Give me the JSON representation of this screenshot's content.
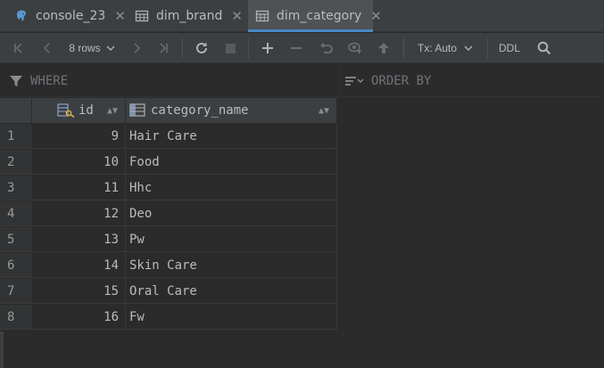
{
  "tabs": [
    {
      "label": "console_23",
      "icon": "postgresql-elephant-icon",
      "active": false
    },
    {
      "label": "dim_brand",
      "icon": "table-icon",
      "active": false
    },
    {
      "label": "dim_category",
      "icon": "table-icon",
      "active": true
    }
  ],
  "toolbar": {
    "rows_label": "8 rows",
    "tx_label": "Tx: Auto",
    "ddl_label": "DDL"
  },
  "filter": {
    "where_placeholder": "WHERE",
    "order_placeholder": "ORDER BY"
  },
  "grid": {
    "columns": [
      {
        "name": "id",
        "icon": "primary-key-column-icon"
      },
      {
        "name": "category_name",
        "icon": "column-icon"
      }
    ],
    "rows": [
      {
        "num": "1",
        "id": "9",
        "category_name": "Hair Care"
      },
      {
        "num": "2",
        "id": "10",
        "category_name": "Food"
      },
      {
        "num": "3",
        "id": "11",
        "category_name": "Hhc"
      },
      {
        "num": "4",
        "id": "12",
        "category_name": "Deo"
      },
      {
        "num": "5",
        "id": "13",
        "category_name": "Pw"
      },
      {
        "num": "6",
        "id": "14",
        "category_name": "Skin Care"
      },
      {
        "num": "7",
        "id": "15",
        "category_name": "Oral Care"
      },
      {
        "num": "8",
        "id": "16",
        "category_name": "Fw"
      }
    ]
  },
  "colors": {
    "background": "#2b2b2b",
    "panel": "#3c3f41",
    "accent": "#4a88c7",
    "text": "#bbbbbb"
  }
}
